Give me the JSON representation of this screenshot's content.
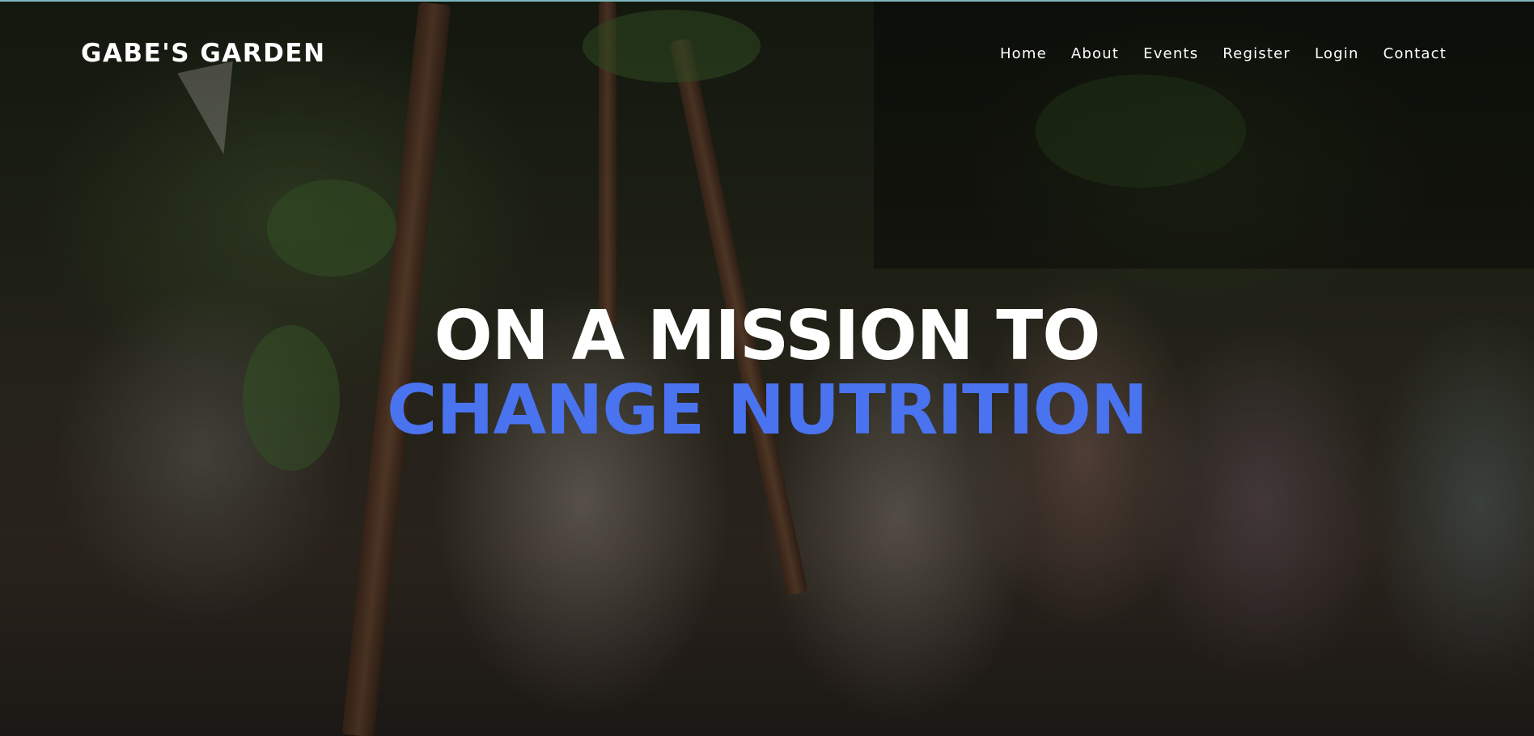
{
  "header": {
    "brand": "GABE'S GARDEN",
    "nav": [
      "Home",
      "About",
      "Events",
      "Register",
      "Login",
      "Contact"
    ]
  },
  "hero": {
    "line1": "ON A MISSION TO",
    "line2": "CHANGE NUTRITION",
    "background_image": "children-holding-vegetables-photo"
  },
  "colors": {
    "accent": "#4a73f0",
    "text": "#ffffff",
    "top_border": "#7fb6bd"
  }
}
